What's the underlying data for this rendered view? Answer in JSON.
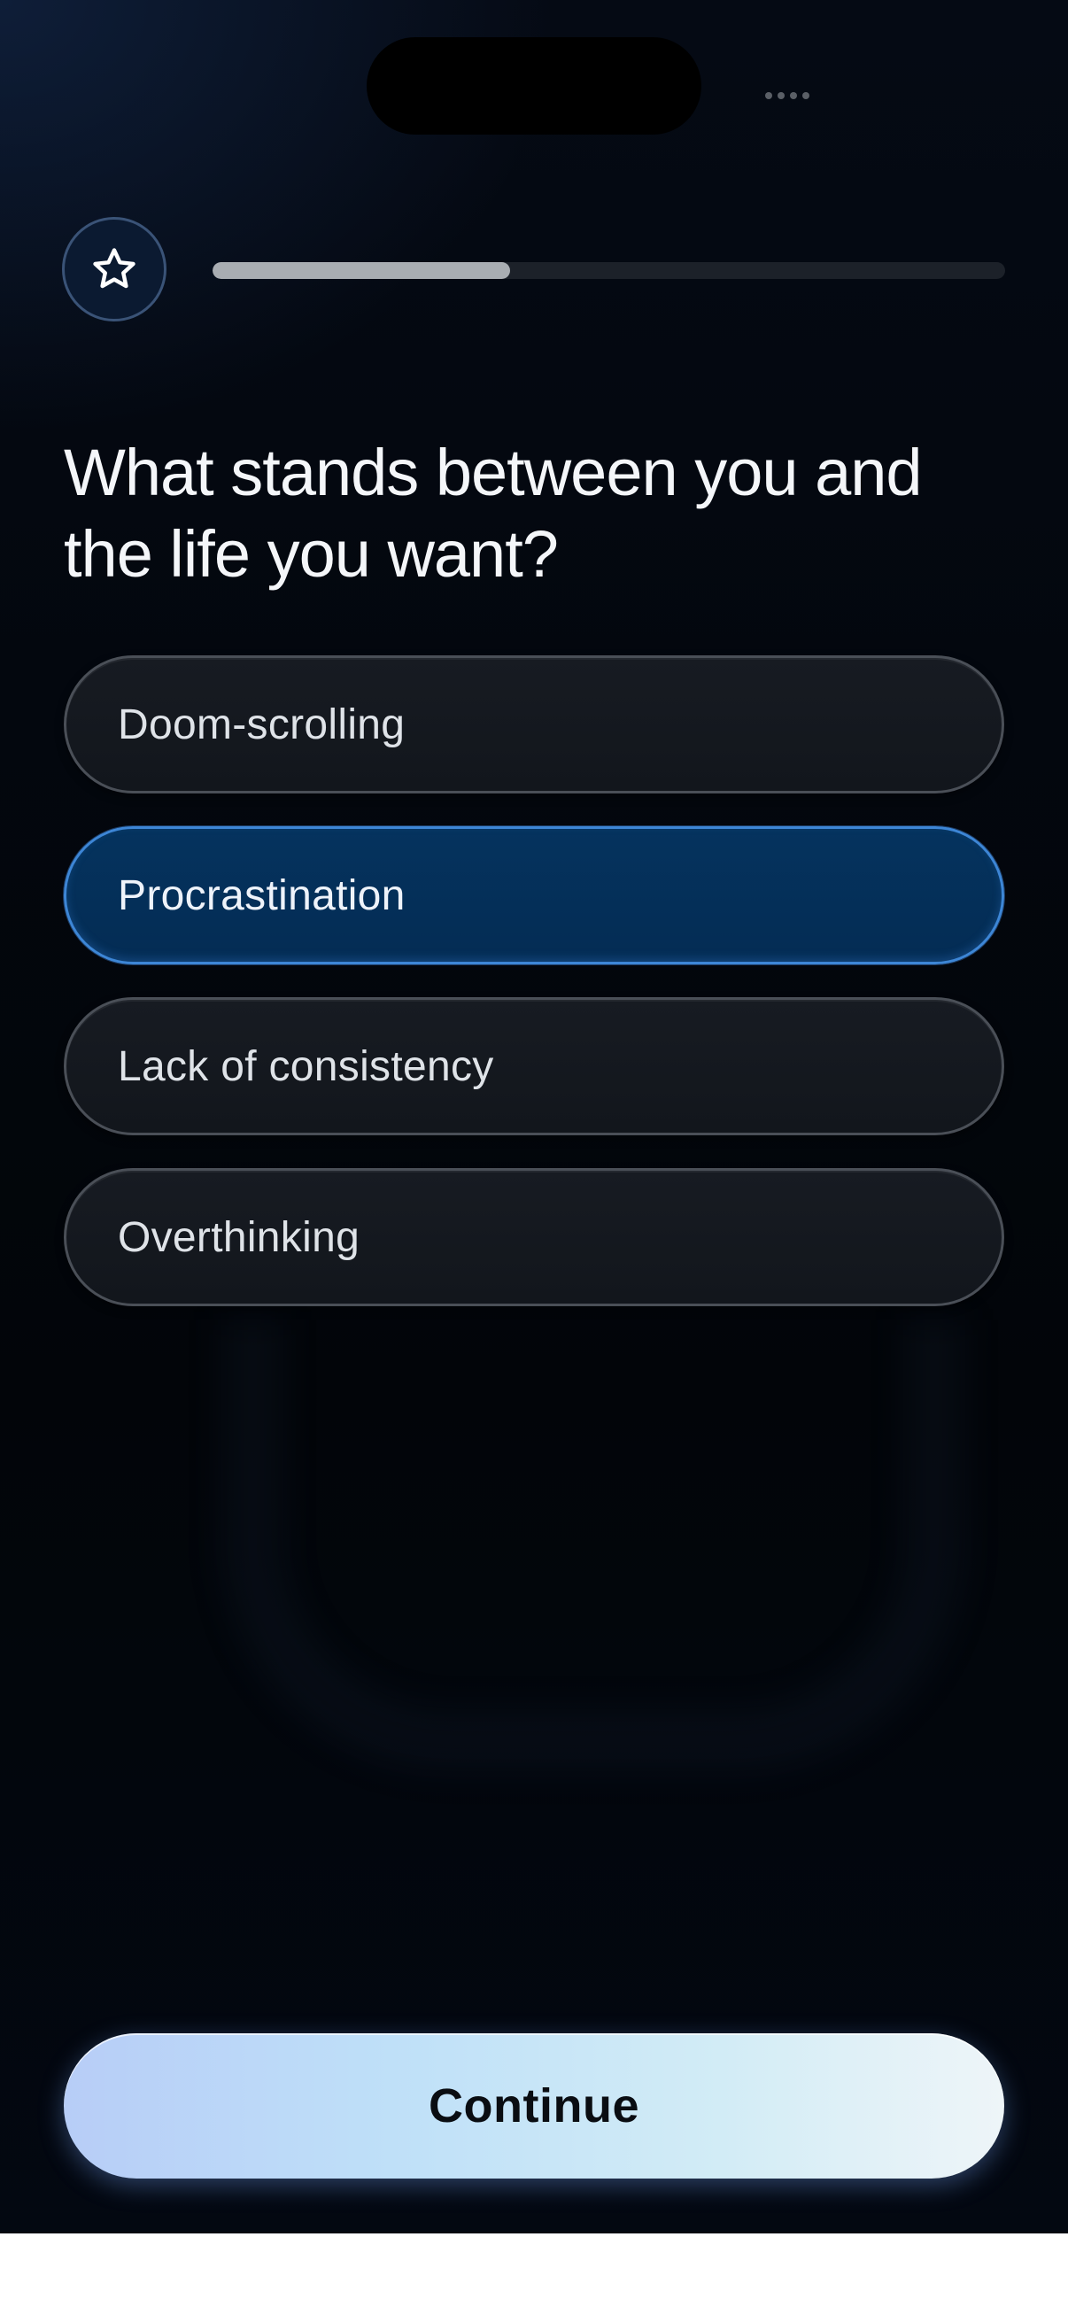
{
  "header": {
    "progress": {
      "value": 0.375
    },
    "badge_icon": "star-outline-icon"
  },
  "question": {
    "title": "What stands between you and the life you want?"
  },
  "options": [
    {
      "label": "Doom-scrolling",
      "selected": false
    },
    {
      "label": "Procrastination",
      "selected": true
    },
    {
      "label": "Lack of consistency",
      "selected": false
    },
    {
      "label": "Overthinking",
      "selected": false
    }
  ],
  "footer": {
    "continue_label": "Continue"
  },
  "colors": {
    "selected_fill": "#05335e",
    "selected_border": "#3d86d6",
    "progress_fill": "#a9adb2",
    "accent_glow": "#8fb8ff"
  }
}
